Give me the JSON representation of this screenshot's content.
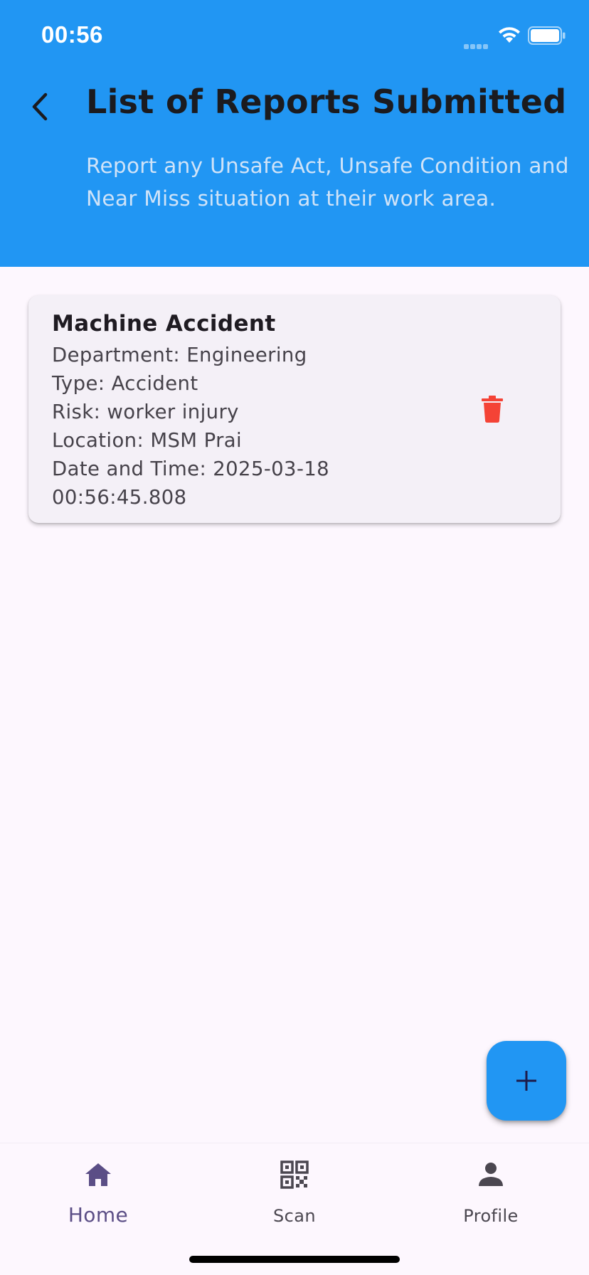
{
  "status_bar": {
    "time": "00:56"
  },
  "header": {
    "title": "List of Reports Submitted",
    "subtitle": "Report any Unsafe Act, Unsafe Condition and Near Miss situation at their work area.",
    "background_color": "#2196f3"
  },
  "reports": [
    {
      "title": "Machine Accident",
      "department": "Department: Engineering",
      "type": "Type: Accident",
      "risk": "Risk: worker injury",
      "location": "Location: MSM Prai",
      "datetime_line1": "Date and Time: 2025-03-18",
      "datetime_line2": "00:56:45.808",
      "delete_icon": "trash-icon",
      "delete_color": "#f44336"
    }
  ],
  "fab": {
    "icon": "plus-icon",
    "color": "#2196f3"
  },
  "bottom_nav": {
    "items": [
      {
        "label": "Home",
        "icon": "home-icon",
        "active": true
      },
      {
        "label": "Scan",
        "icon": "qr-code-icon",
        "active": false
      },
      {
        "label": "Profile",
        "icon": "person-icon",
        "active": false
      }
    ],
    "active_color": "#5b4e86",
    "inactive_color": "#4b4750"
  }
}
